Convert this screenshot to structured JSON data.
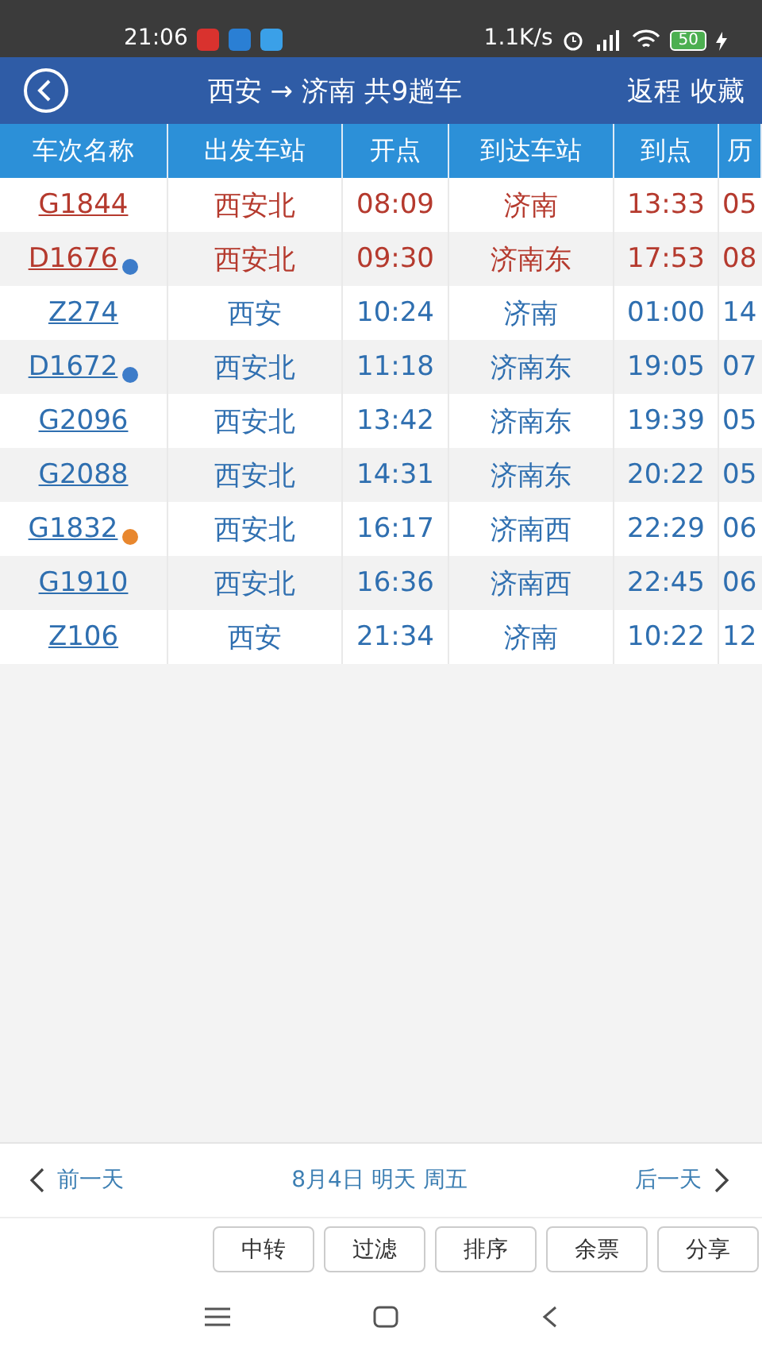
{
  "status_bar": {
    "time": "21:06",
    "network_speed": "1.1K/s",
    "battery": "50"
  },
  "header": {
    "title": "西安 → 济南 共9趟车",
    "actions": [
      "返程",
      "收藏"
    ]
  },
  "table": {
    "columns": [
      "车次名称",
      "出发车站",
      "开点",
      "到达车站",
      "到点",
      "历"
    ],
    "rows": [
      {
        "train": "G1844",
        "highlighted": true,
        "badge": null,
        "from": "西安北",
        "depart": "08:09",
        "to": "济南",
        "arrive": "13:33",
        "column_6": "05"
      },
      {
        "train": "D1676",
        "highlighted": true,
        "badge": {
          "color": "#3d7cc9"
        },
        "from": "西安北",
        "depart": "09:30",
        "to": "济南东",
        "arrive": "17:53",
        "column_6": "08"
      },
      {
        "train": "Z274",
        "highlighted": false,
        "badge": null,
        "from": "西安",
        "depart": "10:24",
        "to": "济南",
        "arrive": "01:00",
        "column_6": "14"
      },
      {
        "train": "D1672",
        "highlighted": false,
        "badge": {
          "color": "#3d7cc9"
        },
        "from": "西安北",
        "depart": "11:18",
        "to": "济南东",
        "arrive": "19:05",
        "column_6": "07"
      },
      {
        "train": "G2096",
        "highlighted": false,
        "badge": null,
        "from": "西安北",
        "depart": "13:42",
        "to": "济南东",
        "arrive": "19:39",
        "column_6": "05"
      },
      {
        "train": "G2088",
        "highlighted": false,
        "badge": null,
        "from": "西安北",
        "depart": "14:31",
        "to": "济南东",
        "arrive": "20:22",
        "column_6": "05"
      },
      {
        "train": "G1832",
        "highlighted": false,
        "badge": {
          "color": "#e8872e"
        },
        "from": "西安北",
        "depart": "16:17",
        "to": "济南西",
        "arrive": "22:29",
        "column_6": "06"
      },
      {
        "train": "G1910",
        "highlighted": false,
        "badge": null,
        "from": "西安北",
        "depart": "16:36",
        "to": "济南西",
        "arrive": "22:45",
        "column_6": "06"
      },
      {
        "train": "Z106",
        "highlighted": false,
        "badge": null,
        "from": "西安",
        "depart": "21:34",
        "to": "济南",
        "arrive": "10:22",
        "column_6": "12"
      }
    ]
  },
  "day_nav": {
    "previous": "前一天",
    "date": "8月4日 明天 周五",
    "next": "后一天"
  },
  "buttons": [
    "中转",
    "过滤",
    "排序",
    "余票",
    "分享"
  ]
}
